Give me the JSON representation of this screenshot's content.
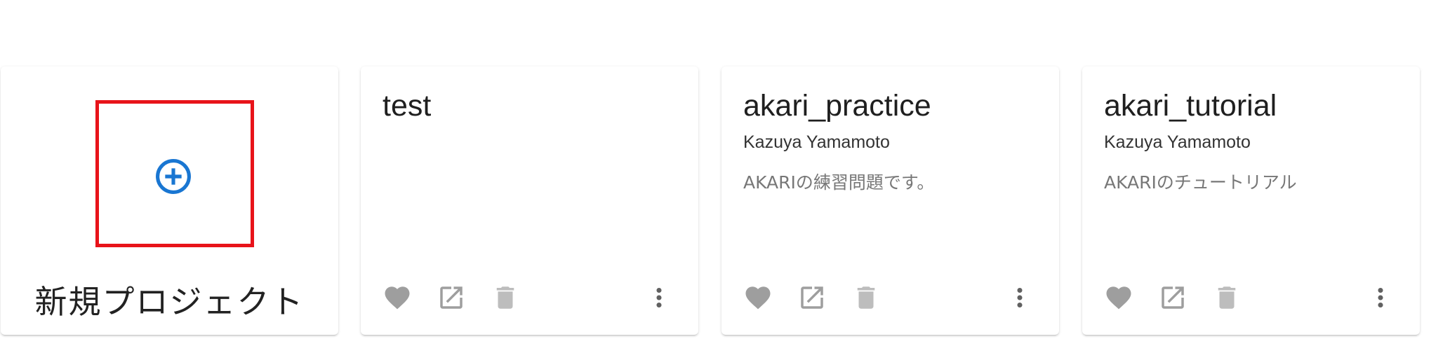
{
  "new_project": {
    "label": "新規プロジェクト",
    "icon": "add-circle-outline-icon",
    "icon_color": "#1976d2",
    "highlight_color": "#e8131a"
  },
  "projects": [
    {
      "title": "test",
      "author": "",
      "description": ""
    },
    {
      "title": "akari_practice",
      "author": "Kazuya Yamamoto",
      "description": "AKARIの練習問題です。"
    },
    {
      "title": "akari_tutorial",
      "author": "Kazuya Yamamoto",
      "description": "AKARIのチュートリアル"
    }
  ],
  "actions": {
    "favorite_icon": "heart-icon",
    "open_icon": "open-in-new-icon",
    "delete_icon": "trash-icon",
    "more_icon": "more-vertical-icon",
    "icon_color": "#9e9e9e"
  }
}
